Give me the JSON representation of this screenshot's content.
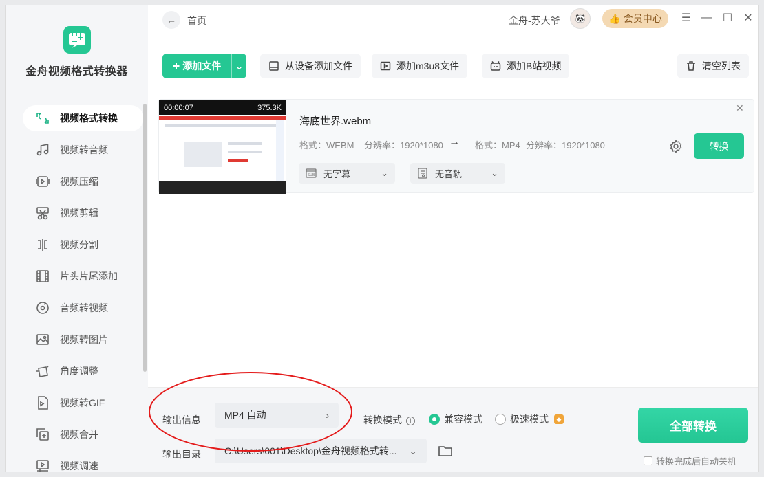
{
  "app": {
    "title": "金舟视频格式转换器",
    "logo": "video-convert-logo"
  },
  "sidebar": {
    "items": [
      {
        "label": "视频格式转换",
        "icon": "format-convert-icon",
        "active": true
      },
      {
        "label": "视频转音频",
        "icon": "music-note-icon"
      },
      {
        "label": "视频压缩",
        "icon": "compress-icon"
      },
      {
        "label": "视频剪辑",
        "icon": "scissors-icon"
      },
      {
        "label": "视频分割",
        "icon": "split-icon"
      },
      {
        "label": "片头片尾添加",
        "icon": "film-icon"
      },
      {
        "label": "音频转视频",
        "icon": "audio-disc-icon"
      },
      {
        "label": "视频转图片",
        "icon": "image-icon"
      },
      {
        "label": "角度调整",
        "icon": "rotate-icon"
      },
      {
        "label": "视频转GIF",
        "icon": "gif-icon"
      },
      {
        "label": "视频合并",
        "icon": "merge-icon"
      },
      {
        "label": "视频调速",
        "icon": "speed-icon"
      }
    ]
  },
  "header": {
    "breadcrumb": "首页",
    "user_name": "金舟-苏大爷",
    "vip_label": "会员中心",
    "accent": "#25c793"
  },
  "toolbar": {
    "add_file": "添加文件",
    "add_from_device": "从设备添加文件",
    "add_m3u8": "添加m3u8文件",
    "add_bilibili": "添加B站视频",
    "clear_list": "清空列表"
  },
  "file": {
    "name": "海底世界.webm",
    "duration": "00:00:07",
    "size": "375.3K",
    "src_format": "格式：WEBM",
    "src_resolution": "分辨率：1920*1080",
    "dst_format": "格式：MP4",
    "dst_resolution": "分辨率：1920*1080",
    "subtitle": "无字幕",
    "audio_track": "无音轨",
    "convert": "转换"
  },
  "bottom": {
    "output_info_label": "输出信息",
    "output_format": "MP4 自动",
    "mode_label": "转换模式",
    "mode_compat": "兼容模式",
    "mode_fast": "极速模式",
    "output_dir_label": "输出目录",
    "output_dir": "C:\\Users\\001\\Desktop\\金舟视频格式转...",
    "convert_all": "全部转换",
    "auto_shutdown": "转换完成后自动关机"
  }
}
